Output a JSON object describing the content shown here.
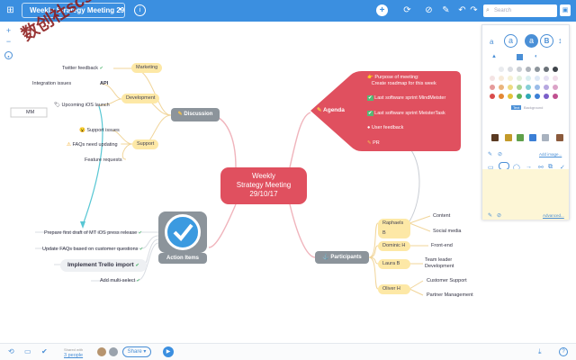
{
  "toolbar": {
    "document_title": "Weekly Strategy Meeting 29...",
    "search_placeholder": "Search",
    "icons": [
      "grid-icon",
      "chevron-down-icon",
      "info-icon",
      "add-icon",
      "refresh-icon",
      "cross-icon",
      "style-icon",
      "undo-icon",
      "redo-icon",
      "search-icon",
      "close-panel-icon"
    ]
  },
  "map": {
    "central": [
      "Weekly",
      "Strategy Meeting",
      "29/10/17"
    ],
    "discussion": {
      "label": "Discussion",
      "marketing": "Marketing",
      "development": "Development",
      "support": "Support",
      "twitter": "Twitter feedback",
      "integration": "Integration issues",
      "api": "API",
      "mm": "MM",
      "ios": "Upcoming iOS launch",
      "support_issues": "Support issues",
      "faqs": "FAQs need updating",
      "feature": "Feature requests"
    },
    "agenda": {
      "label": "Agenda",
      "items": [
        "Purpose of meeting:",
        "Create roadmap for this week",
        "Last software sprint MindMeister",
        "Last software sprint MeisterTask",
        "User feedback",
        "PR"
      ]
    },
    "action_items": {
      "label": "Action Items",
      "items": [
        "Prepare first draft of MT iOS press release",
        "Update FAQs based on customer questions",
        "Implement Trello import",
        "Add multi-select"
      ]
    },
    "participants": {
      "label": "Participants",
      "people": [
        {
          "name": "Raphaels B",
          "roles": [
            "Content",
            "Social media"
          ]
        },
        {
          "name": "Dominic H",
          "roles": [
            "Front-end"
          ]
        },
        {
          "name": "Laura B",
          "roles": [
            "Team leader",
            "Development"
          ]
        },
        {
          "name": "Oliver H",
          "roles": [
            "Customer Support",
            "Partner Management"
          ]
        }
      ]
    }
  },
  "watermark": "数创社scs66",
  "bottom": {
    "shared_with": "Shared with",
    "people": "3 people",
    "share": "Share"
  },
  "panel": {
    "tabs": [
      "Text",
      "Background"
    ],
    "add_image": "Add image...",
    "advanced": "Advanced..."
  },
  "colors": {
    "header": "#3b8fe0",
    "central": "#e0505f",
    "gray_topic": "#8c949b",
    "yellow": "#fde8a6"
  }
}
